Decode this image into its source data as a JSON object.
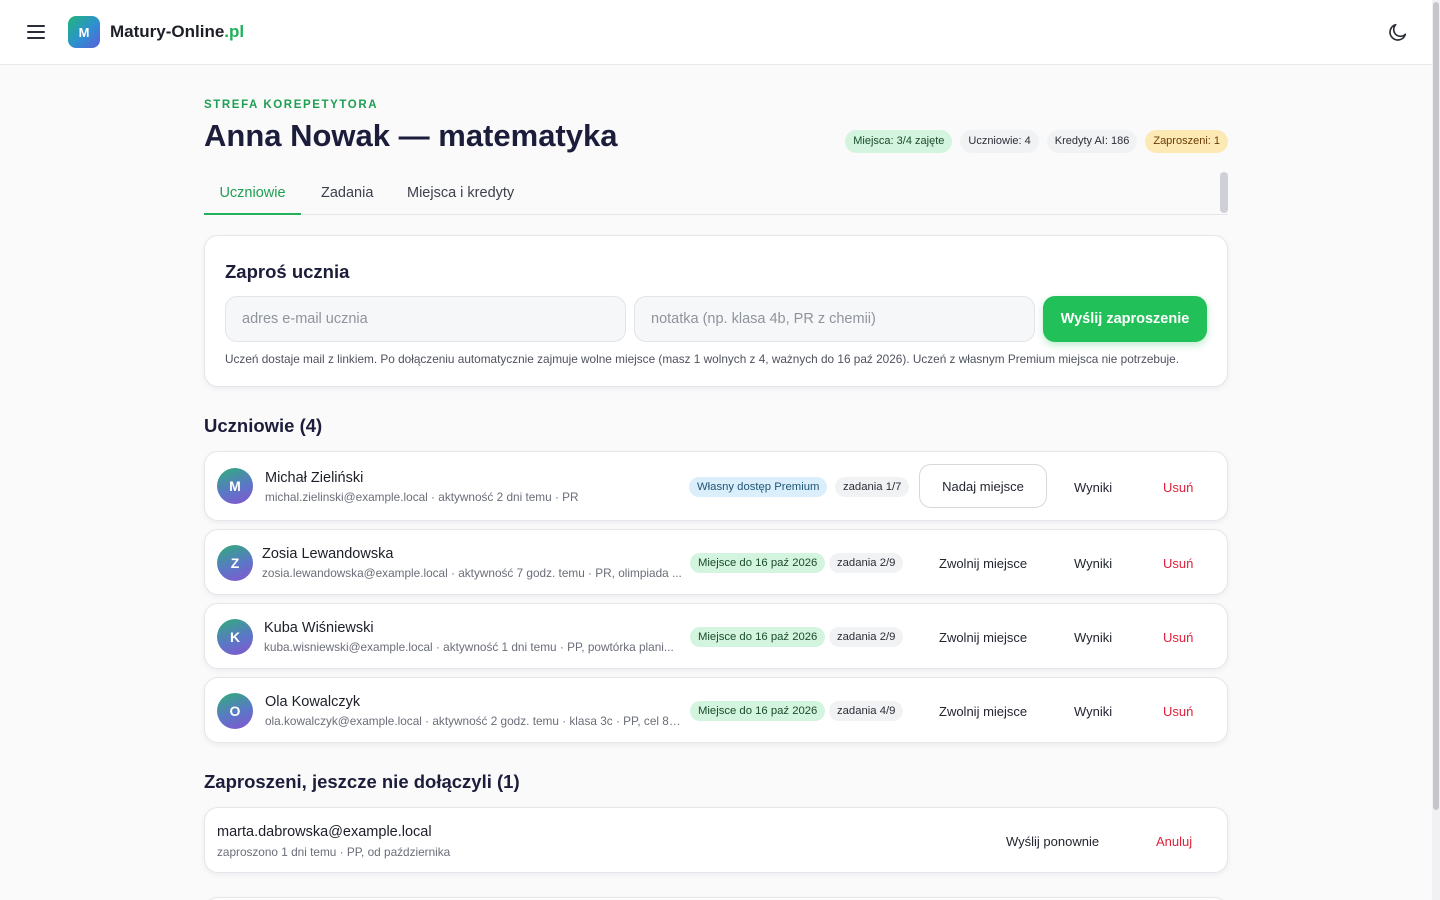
{
  "header": {
    "logo_letter": "M",
    "brand_name": "Matury-Online",
    "brand_tld": ".pl"
  },
  "page": {
    "eyebrow": "STREFA KOREPETYTORA",
    "title": "Anna Nowak — matematyka"
  },
  "stats": {
    "seats": "Miejsca: 3/4 zajęte",
    "students": "Uczniowie: 4",
    "ai_credits": "Kredyty AI: 186",
    "invited": "Zaproszeni: 1"
  },
  "tabs": [
    {
      "label": "Uczniowie",
      "active": true
    },
    {
      "label": "Zadania",
      "active": false
    },
    {
      "label": "Miejsca i kredyty",
      "active": false
    }
  ],
  "invite": {
    "title": "Zaproś ucznia",
    "email_placeholder": "adres e-mail ucznia",
    "note_placeholder": "notatka (np. klasa 4b, PR z chemii)",
    "send_label": "Wyślij zaproszenie",
    "help": "Uczeń dostaje mail z linkiem. Po dołączeniu automatycznie zajmuje wolne miejsce (masz 1 wolnych z 4, ważnych do 16 paź 2026). Uczeń z własnym Premium miejsca nie potrzebuje."
  },
  "students_section": {
    "title": "Uczniowie (4)",
    "rows": [
      {
        "initial": "M",
        "name": "Michał Zieliński",
        "meta": "michal.zielinski@example.local · aktywność 2 dni temu · PR",
        "status": "Własny dostęp Premium",
        "tasks": "zadania 1/7",
        "seat_action": "Nadaj miejsce",
        "results": "Wyniki",
        "remove": "Usuń"
      },
      {
        "initial": "Z",
        "name": "Zosia Lewandowska",
        "meta": "zosia.lewandowska@example.local · aktywność 7 godz. temu · PR, olimpiada ...",
        "status": "Miejsce do 16 paź 2026",
        "tasks": "zadania 2/9",
        "seat_action": "Zwolnij miejsce",
        "results": "Wyniki",
        "remove": "Usuń"
      },
      {
        "initial": "K",
        "name": "Kuba Wiśniewski",
        "meta": "kuba.wisniewski@example.local · aktywność 1 dni temu · PP, powtórka plani...",
        "status": "Miejsce do 16 paź 2026",
        "tasks": "zadania 2/9",
        "seat_action": "Zwolnij miejsce",
        "results": "Wyniki",
        "remove": "Usuń"
      },
      {
        "initial": "O",
        "name": "Ola Kowalczyk",
        "meta": "ola.kowalczyk@example.local · aktywność 2 godz. temu · klasa 3c · PP, cel 80...",
        "status": "Miejsce do 16 paź 2026",
        "tasks": "zadania 4/9",
        "seat_action": "Zwolnij miejsce",
        "results": "Wyniki",
        "remove": "Usuń"
      }
    ]
  },
  "pending_section": {
    "title": "Zaproszeni, jeszcze nie dołączyli (1)",
    "rows": [
      {
        "email": "marta.dabrowska@example.local",
        "meta": "zaproszono 1 dni temu · PP, od października",
        "resend": "Wyślij ponownie",
        "cancel": "Anuluj"
      }
    ]
  }
}
